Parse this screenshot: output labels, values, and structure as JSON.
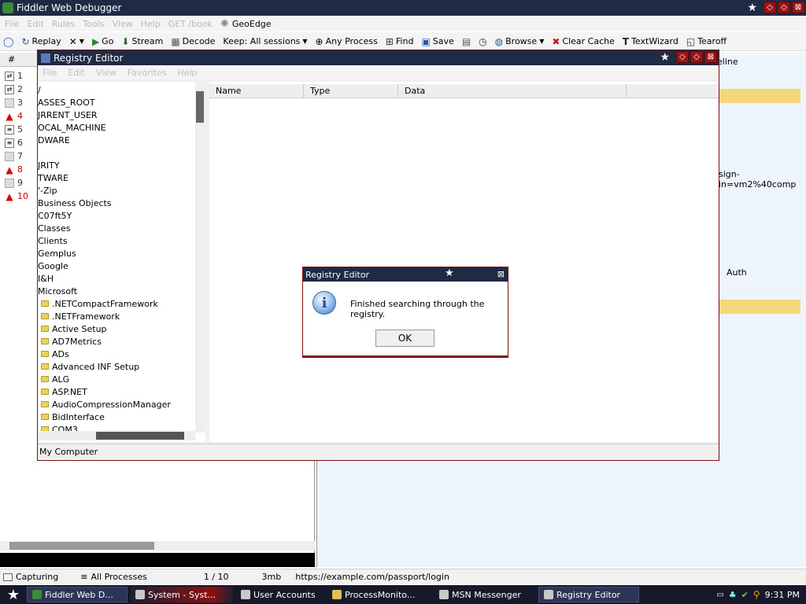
{
  "fiddler": {
    "title": "Fiddler Web Debugger",
    "menu": [
      "File",
      "Edit",
      "Rules",
      "Tools",
      "View",
      "Help",
      "GET /book"
    ],
    "geoedge": "GeoEdge",
    "toolbar": {
      "replay": "Replay",
      "go": "Go",
      "stream": "Stream",
      "decode": "Decode",
      "keep": "Keep: All sessions",
      "any_process": "Any Process",
      "find": "Find",
      "save": "Save",
      "browse": "Browse",
      "clear_cache": "Clear Cache",
      "textwizard": "TextWizard",
      "tearoff": "Tearoff"
    },
    "sessions_header": "#",
    "sessions": [
      "1",
      "2",
      "3",
      "4",
      "5",
      "6",
      "7",
      "8",
      "9",
      "10"
    ],
    "right_fragments": {
      "tab_timeline": "eline",
      "signin": "sign-in=vm2%40comp",
      "auth": "Auth"
    },
    "status": {
      "capturing": "Capturing",
      "processes": "All Processes",
      "count": "1 / 10",
      "mem": "3mb",
      "url": "https://example.com/passport/login"
    }
  },
  "regedit": {
    "title": "Registry Editor",
    "menu": [
      "File",
      "Edit",
      "View",
      "Favorites",
      "Help"
    ],
    "tree": [
      "/",
      "ASSES_ROOT",
      "JRRENT_USER",
      "OCAL_MACHINE",
      "DWARE",
      "",
      "JRITY",
      "TWARE",
      "'-Zip",
      "Business Objects",
      "C07ft5Y",
      "Classes",
      "Clients",
      "Gemplus",
      "Google",
      "I&H",
      "Microsoft"
    ],
    "subfolders": [
      ".NETCompactFramework",
      ".NETFramework",
      "Active Setup",
      "AD7Metrics",
      "ADs",
      "Advanced INF Setup",
      "ALG",
      "ASP.NET",
      "AudioCompressionManager",
      "BidInterface",
      "COM3"
    ],
    "columns": [
      "Name",
      "Type",
      "Data"
    ],
    "status": "My Computer"
  },
  "dialog": {
    "title": "Registry Editor",
    "message": "Finished searching through the registry.",
    "ok": "OK"
  },
  "taskbar": {
    "items": [
      "Fiddler Web D...",
      "System - Syst...",
      "User Accounts",
      "ProcessMonito...",
      "MSN Messenger",
      "Registry Editor"
    ],
    "clock": "9:31 PM"
  }
}
